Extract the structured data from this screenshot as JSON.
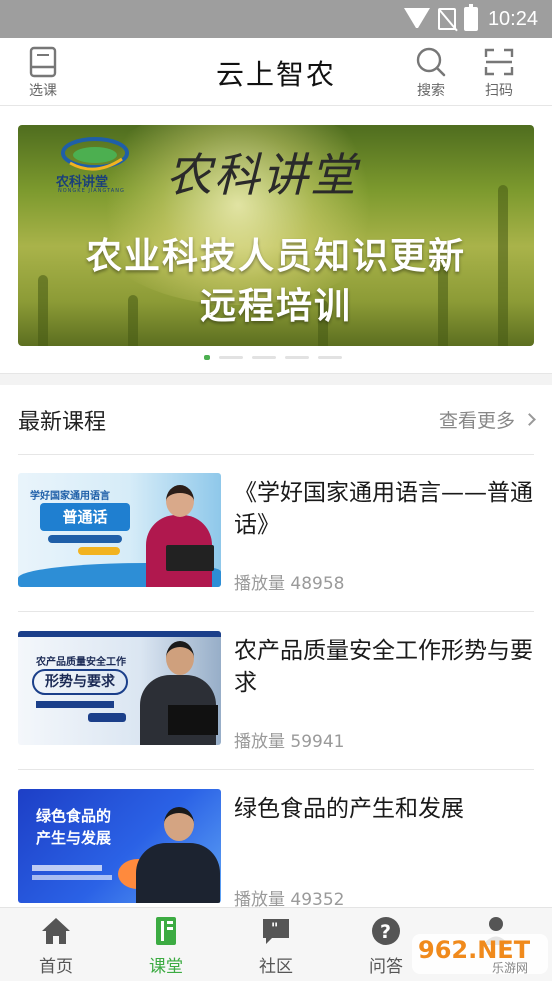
{
  "status_bar": {
    "time": "10:24"
  },
  "header": {
    "title": "云上智农",
    "select_course_label": "选课",
    "search_label": "搜索",
    "scan_label": "扫码"
  },
  "banner": {
    "logo_text": "农科讲堂",
    "logo_subtext": "NONGKE JIANGTANG",
    "title": "农科讲堂",
    "line1": "农业科技人员知识更新",
    "line2": "远程培训",
    "active_slide": 1,
    "slide_count": 5
  },
  "latest_courses": {
    "title": "最新课程",
    "more_label": "查看更多",
    "items": [
      {
        "title": "《学好国家通用语言——普通话》",
        "plays": "播放量 48958",
        "thumb_title": "学好国家通用语言",
        "thumb_badge": "普通话"
      },
      {
        "title": "农产品质量安全工作形势与要求",
        "plays": "播放量 59941",
        "thumb_title": "农产品质量安全工作",
        "thumb_badge": "形势与要求"
      },
      {
        "title": "绿色食品的产生和发展",
        "plays": "播放量 49352",
        "thumb_title": "绿色食品的\n产生与发展"
      }
    ]
  },
  "bottom_nav": {
    "items": [
      {
        "label": "首页",
        "icon": "home-icon"
      },
      {
        "label": "课堂",
        "icon": "classroom-icon",
        "active": true
      },
      {
        "label": "社区",
        "icon": "community-icon"
      },
      {
        "label": "问答",
        "icon": "question-icon"
      },
      {
        "label": "",
        "icon": "profile-icon"
      }
    ]
  },
  "colors": {
    "accent_green": "#3cab42",
    "status_bar": "#9e9e9e",
    "text_secondary": "#9a9a9a"
  },
  "watermark": {
    "text": "962.NET",
    "subtext": "乐游网"
  }
}
